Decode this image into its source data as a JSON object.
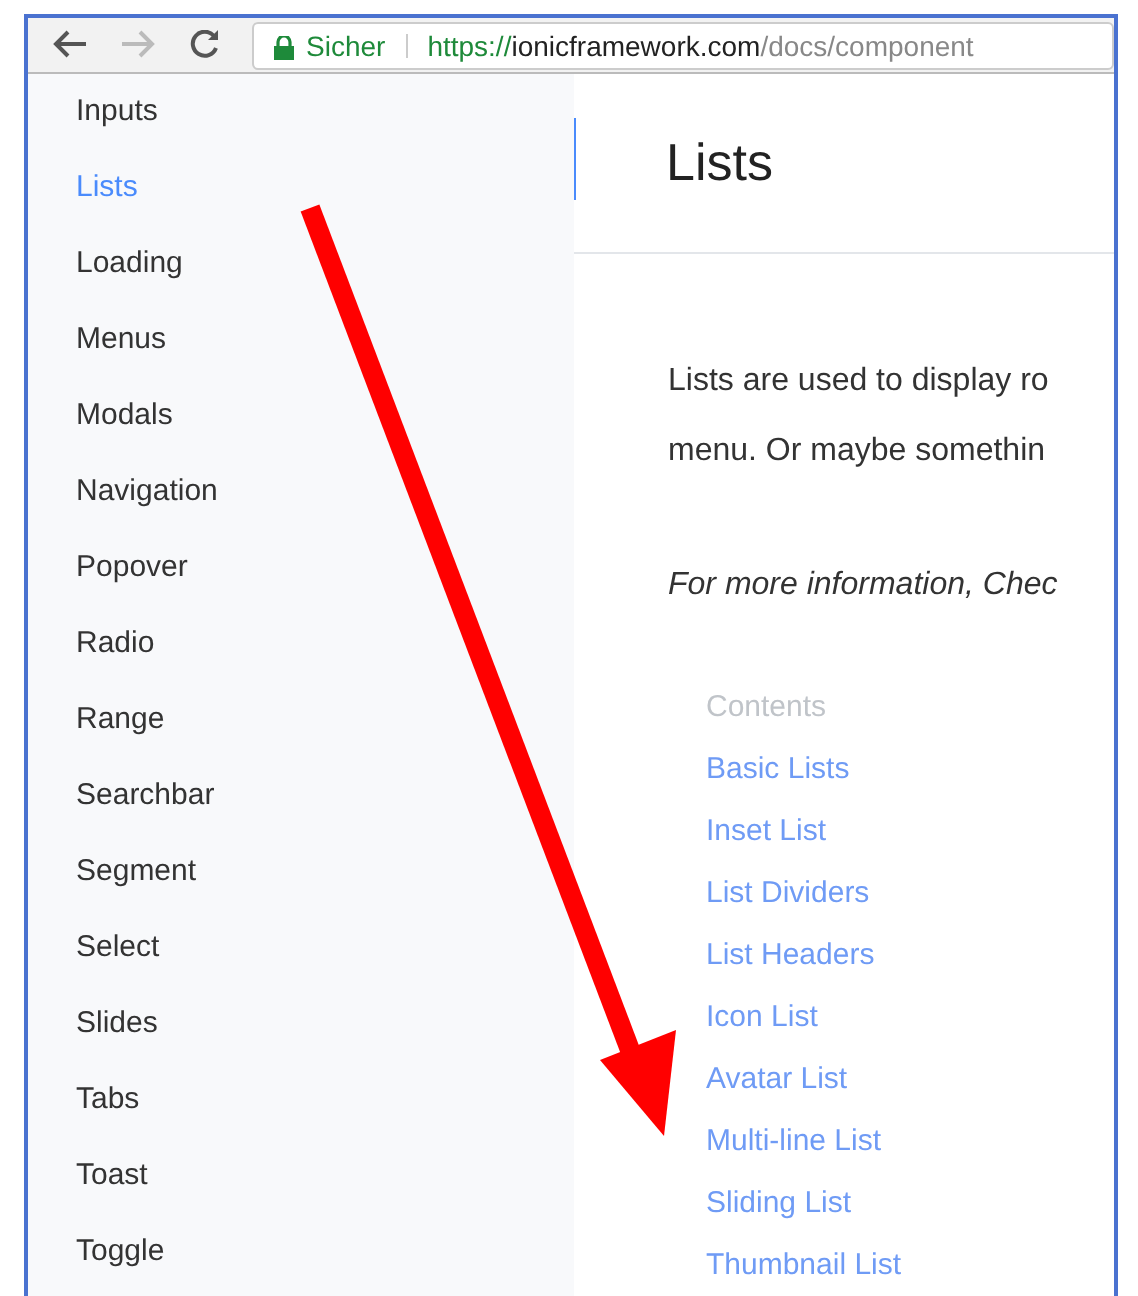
{
  "browser": {
    "security": "Sicher",
    "url": [
      {
        "kind": "scheme",
        "text": "https://"
      },
      {
        "kind": "host",
        "text": "ionicframework.com"
      },
      {
        "kind": "path",
        "text": "/docs/component"
      }
    ]
  },
  "sidebar": {
    "items": [
      {
        "label": "Inputs",
        "selected": false
      },
      {
        "label": "Lists",
        "selected": true
      },
      {
        "label": "Loading",
        "selected": false
      },
      {
        "label": "Menus",
        "selected": false
      },
      {
        "label": "Modals",
        "selected": false
      },
      {
        "label": "Navigation",
        "selected": false
      },
      {
        "label": "Popover",
        "selected": false
      },
      {
        "label": "Radio",
        "selected": false
      },
      {
        "label": "Range",
        "selected": false
      },
      {
        "label": "Searchbar",
        "selected": false
      },
      {
        "label": "Segment",
        "selected": false
      },
      {
        "label": "Select",
        "selected": false
      },
      {
        "label": "Slides",
        "selected": false
      },
      {
        "label": "Tabs",
        "selected": false
      },
      {
        "label": "Toast",
        "selected": false
      },
      {
        "label": "Toggle",
        "selected": false
      }
    ]
  },
  "content": {
    "title": "Lists",
    "paragraph_lines": [
      "Lists are used to display ro",
      "menu. Or maybe somethin"
    ],
    "note": "For more information, Chec",
    "contents_heading": "Contents",
    "contents": [
      "Basic Lists",
      "Inset List",
      "List Dividers",
      "List Headers",
      "Icon List",
      "Avatar List",
      "Multi-line List",
      "Sliding List",
      "Thumbnail List"
    ]
  }
}
